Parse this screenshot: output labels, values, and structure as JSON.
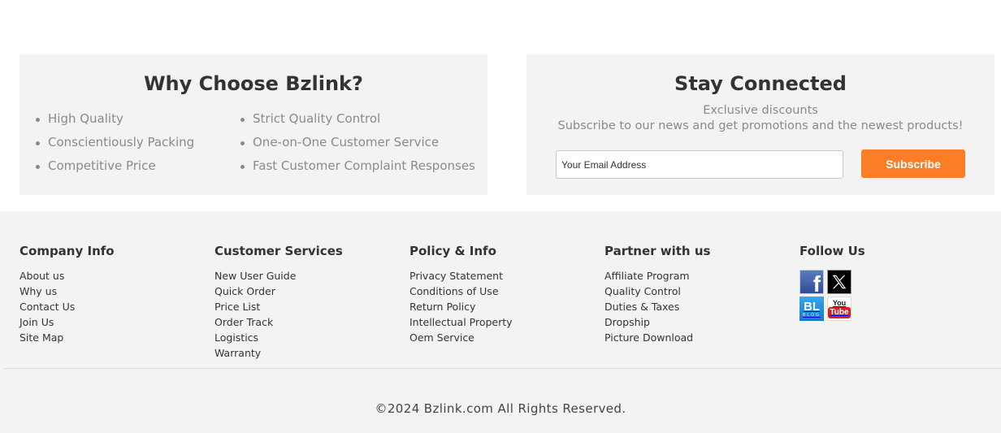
{
  "why": {
    "title": "Why Choose Bzlink?",
    "col1": [
      "High Quality",
      "Conscientiously Packing",
      "Competitive Price"
    ],
    "col2": [
      "Strict Quality Control",
      "One-on-One Customer Service",
      "Fast Customer Complaint Responses"
    ]
  },
  "stay": {
    "title": "Stay Connected",
    "line1": "Exclusive discounts",
    "line2": "Subscribe to our news and get promotions and the newest products!",
    "email_placeholder": "Your Email Address",
    "subscribe_label": "Subscribe",
    "button_color": "#fb7e26"
  },
  "footer": {
    "company": {
      "title": "Company Info",
      "links": [
        "About us",
        "Why us",
        "Contact Us",
        "Join Us",
        "Site Map"
      ]
    },
    "services": {
      "title": "Customer Services",
      "links": [
        "New User Guide",
        "Quick Order",
        "Price List",
        "Order Track",
        "Logistics",
        "Warranty"
      ]
    },
    "policy": {
      "title": "Policy & Info",
      "links": [
        "Privacy Statement",
        "Conditions of Use",
        "Return Policy",
        "Intellectual Property",
        "Oem Service"
      ]
    },
    "partner": {
      "title": "Partner with us",
      "links": [
        "Affiliate Program",
        "Quality Control",
        "Duties & Taxes",
        "Dropship",
        "Picture Download"
      ]
    },
    "follow": {
      "title": "Follow Us",
      "icons": [
        "facebook-icon",
        "x-twitter-icon",
        "blog-icon",
        "youtube-icon"
      ],
      "fb_glyph": "f",
      "blog_glyph": "BL",
      "blog_small": "BLOG",
      "yt_you": "You",
      "yt_tube": "Tube"
    },
    "copyright": "©2024 Bzlink.com All Rights Reserved."
  }
}
